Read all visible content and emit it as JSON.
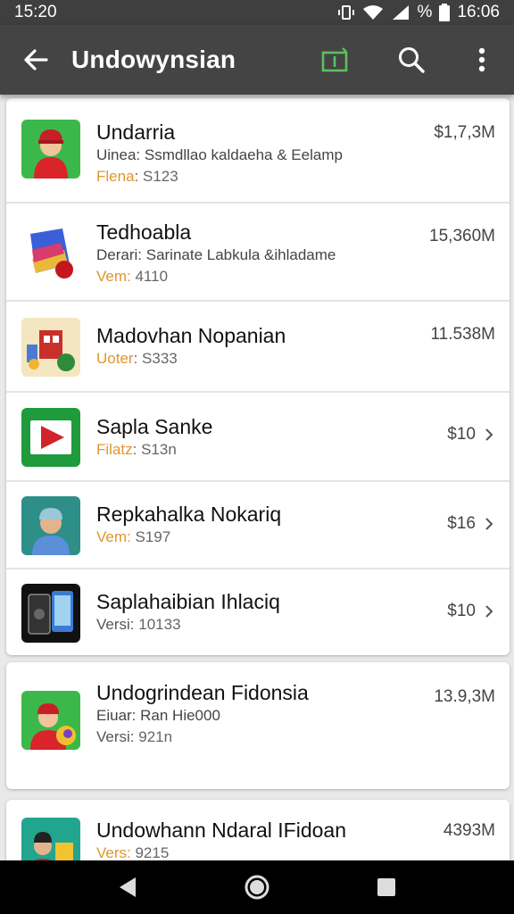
{
  "status": {
    "time": "15:20",
    "battery_pct": "%",
    "right_time": "16:06"
  },
  "appbar": {
    "title": "Undowynsian"
  },
  "apps": [
    {
      "name": "Undarria",
      "subtitle": "Uinea: Ssmdllao kaldaeha & Eelamp",
      "version_label": "Flena",
      "version_value": ": S123",
      "size": "$1,7,3M"
    },
    {
      "name": "Tedhoabla",
      "subtitle": "Derari: Sarinate Labkula &ihladame",
      "version_label": "Vem:",
      "version_value": " 4110",
      "size": "15,360M"
    },
    {
      "name": "Madovhan Nopanian",
      "version_label": "Uoter",
      "version_value": ": S333",
      "size": "11.538M"
    },
    {
      "name": "Sapla Sanke",
      "version_label": "Filatz",
      "version_value": ": S13n",
      "price": "$10"
    },
    {
      "name": "Repkahalka Nokariq",
      "version_label": "Vem:",
      "version_value": " S197",
      "price": "$16"
    },
    {
      "name": "Saplahaibian Ihlaciq",
      "version_label": "Versi:",
      "version_value": " 10133",
      "price": "$10"
    },
    {
      "name": "Undogrindean Fidonsia",
      "subtitle": "Eiuar: Ran Hie000",
      "version_label": "Versi:",
      "version_value": " 921n",
      "size": "13.9,3M"
    },
    {
      "name": "Undowhann Ndaral IFidoan",
      "version_label": "Vers:",
      "version_value": " 9215",
      "size": "4393M"
    }
  ]
}
